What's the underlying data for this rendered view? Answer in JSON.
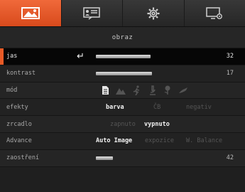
{
  "tabs": [
    {
      "icon": "image-icon",
      "active": true
    },
    {
      "icon": "presentation-icon",
      "active": false
    },
    {
      "icon": "gear-icon",
      "active": false
    },
    {
      "icon": "monitor-settings-icon",
      "active": false
    }
  ],
  "header": {
    "title": "obraz"
  },
  "rows": {
    "jas": {
      "label": "jas",
      "value": "32",
      "level": 0.32
    },
    "kontrast": {
      "label": "kontrast",
      "value": "17",
      "level": 0.33
    },
    "mod": {
      "label": "mód",
      "icons": [
        "document-icon",
        "mountain-icon",
        "running-person-icon",
        "microscope-icon",
        "flower-icon",
        "bird-icon"
      ]
    },
    "efekty": {
      "label": "efekty",
      "options": [
        "barva",
        "ČB",
        "negativ"
      ],
      "selected": "barva"
    },
    "zrcadlo": {
      "label": "zrcadlo",
      "options": [
        "zapnuto",
        "vypnuto"
      ],
      "selected": "vypnuto"
    },
    "advance": {
      "label": "Advance",
      "options": [
        "Auto Image",
        "expozice",
        "W. Balance"
      ],
      "selected": "Auto Image"
    },
    "zaostreni": {
      "label": "zaostření",
      "value": "42",
      "level": 0.1
    }
  },
  "colors": {
    "accent": "#e85a26",
    "background": "#1f1f1f",
    "selected_row": "#060606"
  }
}
